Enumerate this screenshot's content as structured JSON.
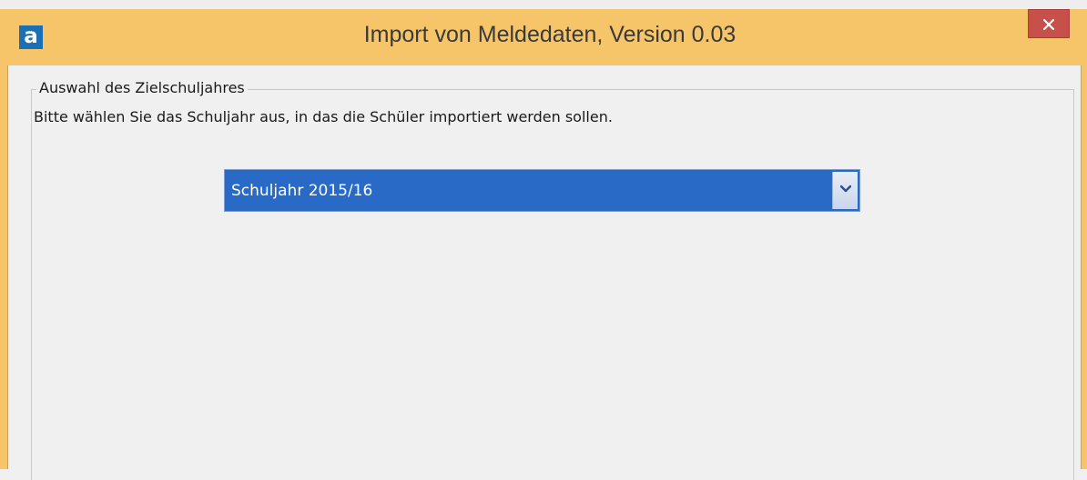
{
  "window": {
    "app_icon_letter": "a",
    "title": "Import von Meldedaten, Version 0.03",
    "close_glyph": "×"
  },
  "group": {
    "legend": "Auswahl des Zielschuljahres",
    "instruction": "Bitte wählen Sie das Schuljahr aus, in das die Schüler importiert werden sollen."
  },
  "school_year_select": {
    "selected_value": "Schuljahr 2015/16",
    "arrow_icon": "chevron-down-icon"
  },
  "colors": {
    "titlebar": "#f7c569",
    "close_button": "#c7504b",
    "select_highlight": "#2a6ac7",
    "app_icon": "#1a6fb5"
  }
}
